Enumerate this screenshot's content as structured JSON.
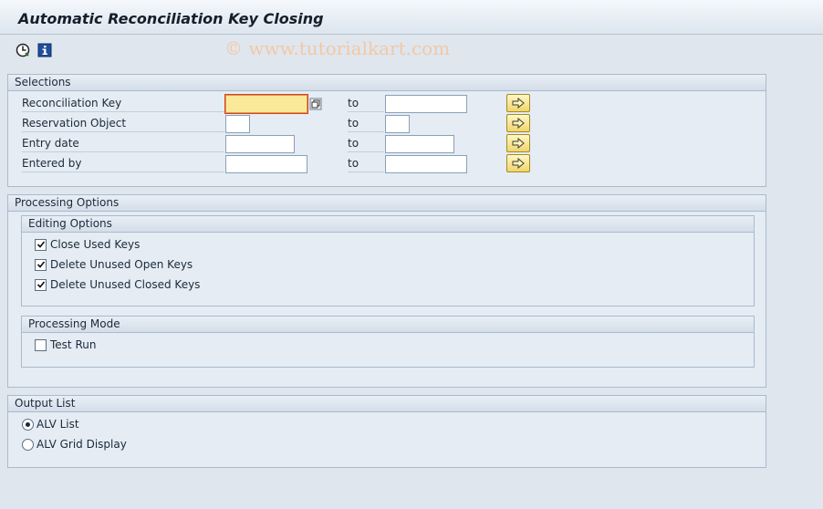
{
  "title": "Automatic Reconciliation Key Closing",
  "watermark": "© www.tutorialkart.com",
  "toolbar": {
    "execute_icon": "execute-clock-icon",
    "info_icon": "info-icon"
  },
  "selections": {
    "header": "Selections",
    "to_label": "to",
    "rows": [
      {
        "label": "Reconciliation Key",
        "from": "",
        "to": ""
      },
      {
        "label": "Reservation Object",
        "from": "",
        "to": ""
      },
      {
        "label": "Entry date",
        "from": "",
        "to": ""
      },
      {
        "label": "Entered by",
        "from": "",
        "to": ""
      }
    ]
  },
  "processing": {
    "header": "Processing Options",
    "editing": {
      "header": "Editing Options",
      "items": [
        {
          "label": "Close Used Keys",
          "checked": true
        },
        {
          "label": "Delete Unused Open Keys",
          "checked": true
        },
        {
          "label": "Delete Unused Closed Keys",
          "checked": true
        }
      ]
    },
    "mode": {
      "header": "Processing Mode",
      "items": [
        {
          "label": "Test Run",
          "checked": false
        }
      ]
    }
  },
  "output": {
    "header": "Output List",
    "options": [
      {
        "label": "ALV List",
        "selected": true
      },
      {
        "label": "ALV Grid Display",
        "selected": false
      }
    ]
  },
  "colors": {
    "required_field": "#fbe99a",
    "arrow_button": "#f1d56a",
    "background": "#dfe6ee"
  }
}
